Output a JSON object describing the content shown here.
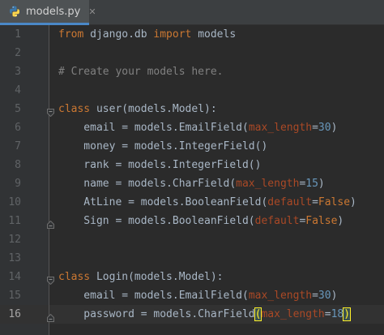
{
  "tab": {
    "filename": "models.py",
    "icon": "python-file-icon",
    "close_glyph": "✕"
  },
  "colors": {
    "keyword": "#cc7832",
    "comment": "#808080",
    "number": "#6897bb",
    "param": "#aa4926",
    "text": "#a9b7c6",
    "background": "#2b2b2b",
    "tab_underline": "#4a88c7"
  },
  "current_line": 16,
  "lines": [
    {
      "n": "1",
      "tokens": [
        [
          "kw",
          "from"
        ],
        [
          "t",
          " django.db "
        ],
        [
          "kw",
          "import"
        ],
        [
          "t",
          " models"
        ]
      ]
    },
    {
      "n": "2",
      "tokens": []
    },
    {
      "n": "3",
      "tokens": [
        [
          "comment",
          "# Create your models here."
        ]
      ]
    },
    {
      "n": "4",
      "tokens": []
    },
    {
      "n": "5",
      "tokens": [
        [
          "kw",
          "class"
        ],
        [
          "t",
          " user(models.Model):"
        ]
      ]
    },
    {
      "n": "6",
      "tokens": [
        [
          "t",
          "    email = models.EmailField("
        ],
        [
          "param",
          "max_length"
        ],
        [
          "t",
          "="
        ],
        [
          "num",
          "30"
        ],
        [
          "t",
          ")"
        ]
      ]
    },
    {
      "n": "7",
      "tokens": [
        [
          "t",
          "    money = models.IntegerField()"
        ]
      ]
    },
    {
      "n": "8",
      "tokens": [
        [
          "t",
          "    rank = models.IntegerField()"
        ]
      ]
    },
    {
      "n": "9",
      "tokens": [
        [
          "t",
          "    name = models.CharField("
        ],
        [
          "param",
          "max_length"
        ],
        [
          "t",
          "="
        ],
        [
          "num",
          "15"
        ],
        [
          "t",
          ")"
        ]
      ]
    },
    {
      "n": "10",
      "tokens": [
        [
          "t",
          "    AtLine = models.BooleanField("
        ],
        [
          "param",
          "default"
        ],
        [
          "t",
          "="
        ],
        [
          "kw",
          "False"
        ],
        [
          "t",
          ")"
        ]
      ]
    },
    {
      "n": "11",
      "tokens": [
        [
          "t",
          "    Sign = models.BooleanField("
        ],
        [
          "param",
          "default"
        ],
        [
          "t",
          "="
        ],
        [
          "kw",
          "False"
        ],
        [
          "t",
          ")"
        ]
      ]
    },
    {
      "n": "12",
      "tokens": []
    },
    {
      "n": "13",
      "tokens": []
    },
    {
      "n": "14",
      "tokens": [
        [
          "kw",
          "class"
        ],
        [
          "t",
          " Login(models.Model):"
        ]
      ]
    },
    {
      "n": "15",
      "tokens": [
        [
          "t",
          "    email = models.EmailField("
        ],
        [
          "param",
          "max_length"
        ],
        [
          "t",
          "="
        ],
        [
          "num",
          "30"
        ],
        [
          "t",
          ")"
        ]
      ]
    },
    {
      "n": "16",
      "tokens": [
        [
          "t",
          "    password = models.CharField"
        ],
        [
          "hl",
          "("
        ],
        [
          "param",
          "max_length"
        ],
        [
          "t",
          "="
        ],
        [
          "num",
          "18"
        ],
        [
          "hl",
          ")"
        ]
      ]
    }
  ],
  "fold_markers": [
    {
      "line": 5,
      "kind": "open"
    },
    {
      "line": 11,
      "kind": "close"
    },
    {
      "line": 14,
      "kind": "open"
    },
    {
      "line": 16,
      "kind": "close"
    }
  ]
}
